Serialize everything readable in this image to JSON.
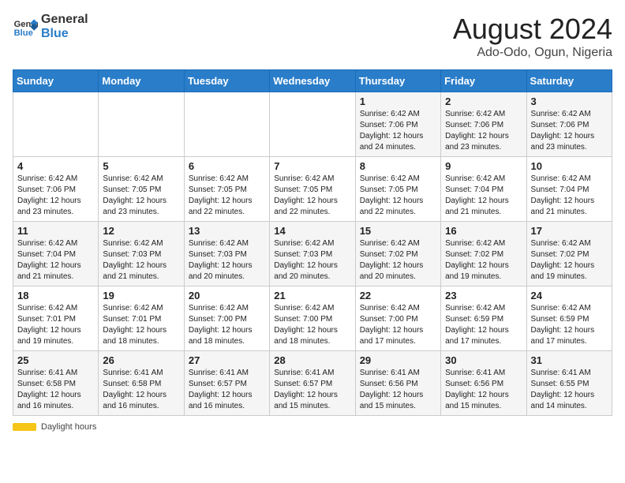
{
  "header": {
    "logo_line1": "General",
    "logo_line2": "Blue",
    "month_year": "August 2024",
    "location": "Ado-Odo, Ogun, Nigeria"
  },
  "days_of_week": [
    "Sunday",
    "Monday",
    "Tuesday",
    "Wednesday",
    "Thursday",
    "Friday",
    "Saturday"
  ],
  "weeks": [
    [
      {
        "num": "",
        "info": ""
      },
      {
        "num": "",
        "info": ""
      },
      {
        "num": "",
        "info": ""
      },
      {
        "num": "",
        "info": ""
      },
      {
        "num": "1",
        "info": "Sunrise: 6:42 AM\nSunset: 7:06 PM\nDaylight: 12 hours\nand 24 minutes."
      },
      {
        "num": "2",
        "info": "Sunrise: 6:42 AM\nSunset: 7:06 PM\nDaylight: 12 hours\nand 23 minutes."
      },
      {
        "num": "3",
        "info": "Sunrise: 6:42 AM\nSunset: 7:06 PM\nDaylight: 12 hours\nand 23 minutes."
      }
    ],
    [
      {
        "num": "4",
        "info": "Sunrise: 6:42 AM\nSunset: 7:06 PM\nDaylight: 12 hours\nand 23 minutes."
      },
      {
        "num": "5",
        "info": "Sunrise: 6:42 AM\nSunset: 7:05 PM\nDaylight: 12 hours\nand 23 minutes."
      },
      {
        "num": "6",
        "info": "Sunrise: 6:42 AM\nSunset: 7:05 PM\nDaylight: 12 hours\nand 22 minutes."
      },
      {
        "num": "7",
        "info": "Sunrise: 6:42 AM\nSunset: 7:05 PM\nDaylight: 12 hours\nand 22 minutes."
      },
      {
        "num": "8",
        "info": "Sunrise: 6:42 AM\nSunset: 7:05 PM\nDaylight: 12 hours\nand 22 minutes."
      },
      {
        "num": "9",
        "info": "Sunrise: 6:42 AM\nSunset: 7:04 PM\nDaylight: 12 hours\nand 21 minutes."
      },
      {
        "num": "10",
        "info": "Sunrise: 6:42 AM\nSunset: 7:04 PM\nDaylight: 12 hours\nand 21 minutes."
      }
    ],
    [
      {
        "num": "11",
        "info": "Sunrise: 6:42 AM\nSunset: 7:04 PM\nDaylight: 12 hours\nand 21 minutes."
      },
      {
        "num": "12",
        "info": "Sunrise: 6:42 AM\nSunset: 7:03 PM\nDaylight: 12 hours\nand 21 minutes."
      },
      {
        "num": "13",
        "info": "Sunrise: 6:42 AM\nSunset: 7:03 PM\nDaylight: 12 hours\nand 20 minutes."
      },
      {
        "num": "14",
        "info": "Sunrise: 6:42 AM\nSunset: 7:03 PM\nDaylight: 12 hours\nand 20 minutes."
      },
      {
        "num": "15",
        "info": "Sunrise: 6:42 AM\nSunset: 7:02 PM\nDaylight: 12 hours\nand 20 minutes."
      },
      {
        "num": "16",
        "info": "Sunrise: 6:42 AM\nSunset: 7:02 PM\nDaylight: 12 hours\nand 19 minutes."
      },
      {
        "num": "17",
        "info": "Sunrise: 6:42 AM\nSunset: 7:02 PM\nDaylight: 12 hours\nand 19 minutes."
      }
    ],
    [
      {
        "num": "18",
        "info": "Sunrise: 6:42 AM\nSunset: 7:01 PM\nDaylight: 12 hours\nand 19 minutes."
      },
      {
        "num": "19",
        "info": "Sunrise: 6:42 AM\nSunset: 7:01 PM\nDaylight: 12 hours\nand 18 minutes."
      },
      {
        "num": "20",
        "info": "Sunrise: 6:42 AM\nSunset: 7:00 PM\nDaylight: 12 hours\nand 18 minutes."
      },
      {
        "num": "21",
        "info": "Sunrise: 6:42 AM\nSunset: 7:00 PM\nDaylight: 12 hours\nand 18 minutes."
      },
      {
        "num": "22",
        "info": "Sunrise: 6:42 AM\nSunset: 7:00 PM\nDaylight: 12 hours\nand 17 minutes."
      },
      {
        "num": "23",
        "info": "Sunrise: 6:42 AM\nSunset: 6:59 PM\nDaylight: 12 hours\nand 17 minutes."
      },
      {
        "num": "24",
        "info": "Sunrise: 6:42 AM\nSunset: 6:59 PM\nDaylight: 12 hours\nand 17 minutes."
      }
    ],
    [
      {
        "num": "25",
        "info": "Sunrise: 6:41 AM\nSunset: 6:58 PM\nDaylight: 12 hours\nand 16 minutes."
      },
      {
        "num": "26",
        "info": "Sunrise: 6:41 AM\nSunset: 6:58 PM\nDaylight: 12 hours\nand 16 minutes."
      },
      {
        "num": "27",
        "info": "Sunrise: 6:41 AM\nSunset: 6:57 PM\nDaylight: 12 hours\nand 16 minutes."
      },
      {
        "num": "28",
        "info": "Sunrise: 6:41 AM\nSunset: 6:57 PM\nDaylight: 12 hours\nand 15 minutes."
      },
      {
        "num": "29",
        "info": "Sunrise: 6:41 AM\nSunset: 6:56 PM\nDaylight: 12 hours\nand 15 minutes."
      },
      {
        "num": "30",
        "info": "Sunrise: 6:41 AM\nSunset: 6:56 PM\nDaylight: 12 hours\nand 15 minutes."
      },
      {
        "num": "31",
        "info": "Sunrise: 6:41 AM\nSunset: 6:55 PM\nDaylight: 12 hours\nand 14 minutes."
      }
    ]
  ],
  "footer": {
    "daylight_label": "Daylight hours"
  }
}
